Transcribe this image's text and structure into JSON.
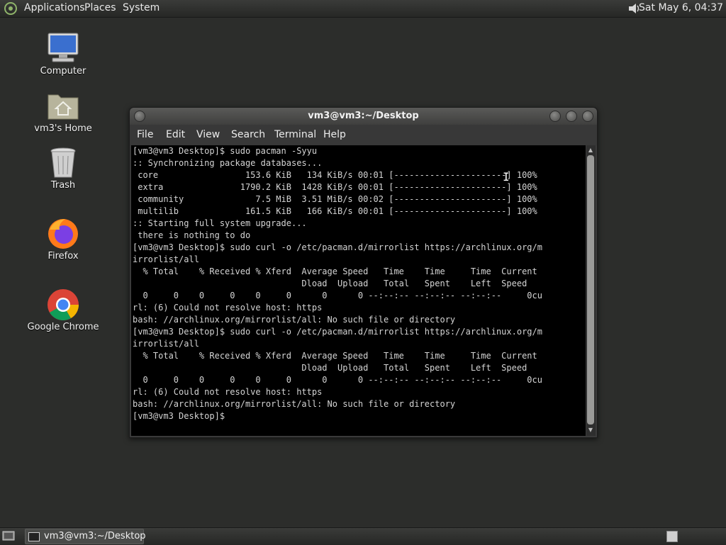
{
  "top_panel": {
    "menu": [
      "Applications",
      "Places",
      "System"
    ],
    "clock": "Sat May  6, 04:37"
  },
  "desktop_icons": [
    {
      "label": "Computer",
      "icon": "computer-icon"
    },
    {
      "label": "vm3's Home",
      "icon": "home-folder-icon"
    },
    {
      "label": "Trash",
      "icon": "trash-icon"
    },
    {
      "label": "Firefox",
      "icon": "firefox-icon"
    },
    {
      "label": "Google Chrome",
      "icon": "chrome-icon"
    }
  ],
  "window": {
    "title": "vm3@vm3:~/Desktop",
    "menu": [
      "File",
      "Edit",
      "View",
      "Search",
      "Terminal",
      "Help"
    ],
    "terminal_lines": [
      "[vm3@vm3 Desktop]$ sudo pacman -Syyu",
      ":: Synchronizing package databases...",
      " core                 153.6 KiB   134 KiB/s 00:01 [----------------------] 100%",
      " extra               1790.2 KiB  1428 KiB/s 00:01 [----------------------] 100%",
      " community              7.5 MiB  3.51 MiB/s 00:02 [----------------------] 100%",
      " multilib             161.5 KiB   166 KiB/s 00:01 [----------------------] 100%",
      ":: Starting full system upgrade...",
      " there is nothing to do",
      "[vm3@vm3 Desktop]$ sudo curl -o /etc/pacman.d/mirrorlist https://archlinux.org/m",
      "irrorlist/all",
      "  % Total    % Received % Xferd  Average Speed   Time    Time     Time  Current",
      "                                 Dload  Upload   Total   Spent    Left  Speed",
      "  0     0    0     0    0     0      0      0 --:--:-- --:--:-- --:--:--     0cu",
      "rl: (6) Could not resolve host: https",
      "bash: //archlinux.org/mirrorlist/all: No such file or directory",
      "[vm3@vm3 Desktop]$ sudo curl -o /etc/pacman.d/mirrorlist https://archlinux.org/m",
      "irrorlist/all",
      "  % Total    % Received % Xferd  Average Speed   Time    Time     Time  Current",
      "                                 Dload  Upload   Total   Spent    Left  Speed",
      "  0     0    0     0    0     0      0      0 --:--:-- --:--:-- --:--:--     0cu",
      "rl: (6) Could not resolve host: https",
      "bash: //archlinux.org/mirrorlist/all: No such file or directory",
      "[vm3@vm3 Desktop]$"
    ]
  },
  "taskbar": {
    "task_label": "vm3@vm3:~/Desktop"
  }
}
